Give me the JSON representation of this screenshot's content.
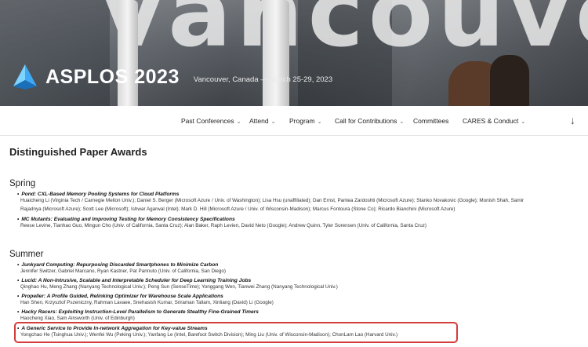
{
  "hero": {
    "logo_text": "ASPLOS 2023",
    "subtitle": "Vancouver, Canada — March 25-29, 2023",
    "sign_text": "vancouver co"
  },
  "nav": {
    "items": [
      {
        "label": "Past Conferences",
        "chevron": "⌄"
      },
      {
        "label": "Attend",
        "chevron": "⌄"
      },
      {
        "label": "Program",
        "chevron": "⌄"
      },
      {
        "label": "Call for Contributions",
        "chevron": "⌄"
      },
      {
        "label": "Committees",
        "chevron": ""
      },
      {
        "label": "CARES & Conduct",
        "chevron": "⌄"
      }
    ],
    "scroll_icon": "↓"
  },
  "page_title": "Distinguished Paper Awards",
  "sections": [
    {
      "title": "Spring",
      "awards": [
        {
          "title": "Pond: CXL-Based Memory Pooling Systems for Cloud Platforms",
          "authors": [
            "Huaicheng Li (Virginia Tech / Carnegie Mellon Univ.); Daniel S. Berger (Microsoft Azure / Univ. of Washington); Lisa Hsu (unaffiliated); Dan Ernst, Pantea Zardoshti (Microsoft Azure); Stanko Novakovic (Google); Monish Shah, Samir",
            "Rajadnya (Microsoft Azure); Scott Lee (Microsoft); Ishwar Agarwal (Intel); Mark D. Hill (Microsoft Azure / Univ. of Wisconsin-Madison); Marcus Fontoura (Stone Co); Ricardo Bianchini (Microsoft Azure)"
          ]
        },
        {
          "title": "MC Mutants: Evaluating and Improving Testing for Memory Consistency Specifications",
          "authors": [
            "Reese Levine, Tianhao Guo, Mingun Cho (Univ. of California, Santa Cruz); Alan Baker, Raph Levien, David Neto (Google); Andrew Quinn, Tyler Sorensen (Univ. of California, Santa Cruz)"
          ]
        }
      ]
    },
    {
      "title": "Summer",
      "awards": [
        {
          "title": "Junkyard Computing: Repurposing Discarded Smartphones to Minimize Carbon",
          "authors": [
            "Jennifer Switzer, Gabriel Marcano, Ryan Kastner, Pat Pannuto (Univ. of California, San Diego)"
          ]
        },
        {
          "title": "Lucid: A Non-Intrusive, Scalable and Interpretable Scheduler for Deep Learning Training Jobs",
          "authors": [
            "Qinghao Hu, Meng Zhang (Nanyang Technological Univ.); Peng Sun (SenseTime); Yonggang Wen, Tianwei Zhang (Nanyang Technological Univ.)"
          ]
        },
        {
          "title": "Propeller: A Profile Guided, Relinking Optimizer for Warehouse Scale Applications",
          "authors": [
            "Han Shen, Krzysztof Pszeniczny, Rahman Lavaee, Snehasish Kumar, Sriraman Tallam, Xinliang (David) Li (Google)"
          ]
        },
        {
          "title": "Hacky Racers: Exploiting Instruction-Level Parallelism to Generate Stealthy Fine-Grained Timers",
          "authors": [
            "Haocheng Xiao, Sam Ainsworth (Univ. of Edinburgh)"
          ]
        },
        {
          "title": "A Generic Service to Provide In-network Aggregation for Key-value Streams",
          "authors": [
            "Yongchao He (Tsinghua Univ.); Wenfei Wu (Peking Univ.); Yanfang Le (Intel, Barefoot Switch Division); Ming Liu (Univ. of Wisconsin-Madison); ChonLam Lao (Harvard Univ.)"
          ]
        }
      ]
    }
  ],
  "colors": {
    "highlight_border": "#d43b3b",
    "logo_mark": "#3fa9f5"
  }
}
